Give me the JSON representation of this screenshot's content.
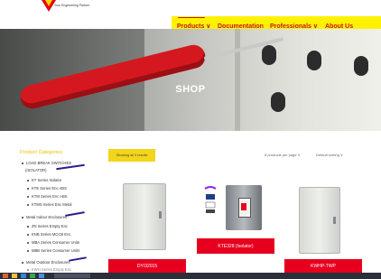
{
  "header": {
    "tagline": "Your Engineering Partner",
    "brand_colors": {
      "yellow": "#fff200",
      "red": "#c4161c"
    }
  },
  "nav": {
    "items": [
      {
        "label": "Products ∨"
      },
      {
        "label": "Documentation"
      },
      {
        "label": "Professionals ∨"
      },
      {
        "label": "About Us"
      }
    ]
  },
  "hero": {
    "title": "SHOP"
  },
  "sidebar": {
    "title": "Product Categories",
    "items": [
      {
        "label": "LOAD BREAK SWITCHES"
      },
      {
        "label": "(ISOLATOR)"
      },
      {
        "label": "KT Series Isolator"
      },
      {
        "label": "KTE Series Enc ABS"
      },
      {
        "label": "KTM Series Enc ABS"
      },
      {
        "label": "KTMS Series Enc Metal"
      },
      {
        "label": "Metal Indoor Enclosures"
      },
      {
        "label": "ZN Series Empty Enc"
      },
      {
        "label": "ENB Series MCCB Enc"
      },
      {
        "label": "MBA Series Consumer Units"
      },
      {
        "label": "MBB Series Consumer Units"
      },
      {
        "label": "Metal Outdoor Enclosures"
      },
      {
        "label": "KWH Series Empty Enc"
      }
    ]
  },
  "toolbar": {
    "showing": "Showing all 3 results",
    "per_page": "8 products per page ∨",
    "sorting": "Default sorting ∨"
  },
  "products": [
    {
      "label": "DY/32015"
    },
    {
      "label": "KTE328 (Isolator)"
    },
    {
      "label": "KWHP-TWP"
    }
  ]
}
